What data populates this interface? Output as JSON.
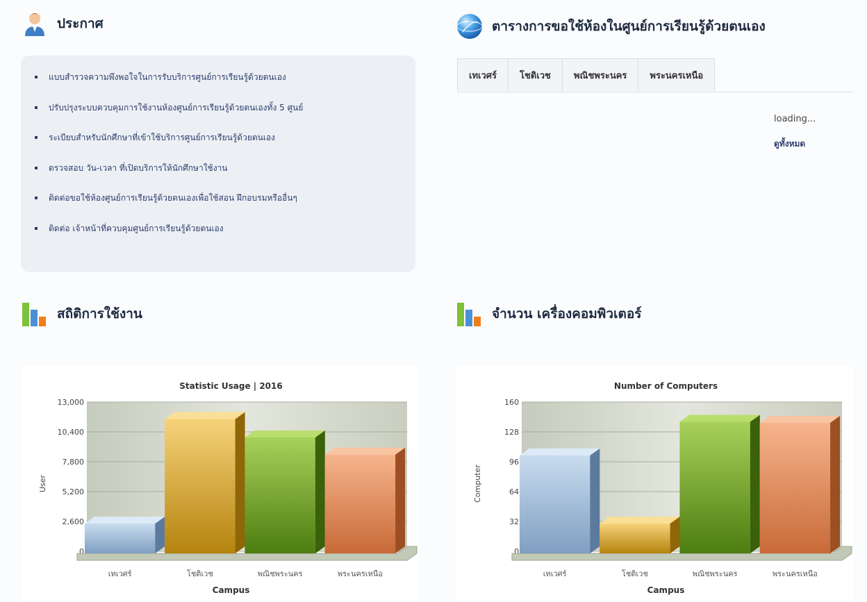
{
  "announcements": {
    "title": "ประกาศ",
    "items": [
      "แบบสำรวจความพึงพอใจในการรับบริการศูนย์การเรียนรู้ด้วยตนเอง",
      "ปรับปรุงระบบควบคุมการใช้งานห้องศูนย์การเรียนรู้ด้วยตนเองทั้ง 5 ศูนย์",
      "ระเบียบสำหรับนักศึกษาที่เข้าใช้บริการศูนย์การเรียนรู้ด้วยตนเอง",
      "ตรวจสอบ วัน-เวลา ที่เปิดบริการให้นักศึกษาใช้งาน",
      "ติดต่อขอใช้ห้องศูนย์การเรียนรู้ด้วยตนเองเพื่อใช้สอน ฝึกอบรมหรืออื่นๆ",
      "ติดต่อ เจ้าหน้าที่ควบคุมศูนย์การเรียนรู้ด้วยตนเอง"
    ]
  },
  "schedule": {
    "title": "ตารางการขอใช้ห้องในศูนย์การเรียนรู้ด้วยตนเอง",
    "tabs": [
      "เทเวศร์",
      "โชติเวช",
      "พณิชพระนคร",
      "พระนครเหนือ"
    ],
    "loading": "loading...",
    "view_all": "ดูทั้งหมด"
  },
  "stats_section": {
    "title": "สถิติการใช้งาน"
  },
  "computers_section": {
    "title": "จำนวน เครื่องคอมพิวเตอร์"
  },
  "colors": {
    "blue": "#a9c4e0",
    "yellow": "#d9a52a",
    "green": "#6a9a1e",
    "orange": "#e08a5a"
  },
  "chart_data": [
    {
      "type": "bar",
      "title": "Statistic Usage | 2016",
      "xlabel": "Campus",
      "ylabel": "User",
      "categories": [
        "เทเวศร์",
        "โชติเวช",
        "พณิชพระนคร",
        "พระนครเหนือ"
      ],
      "values": [
        2600,
        11700,
        10100,
        8600
      ],
      "ylim": [
        0,
        13000
      ],
      "yticks": [
        "0",
        "2,600",
        "5,200",
        "7,800",
        "10,400",
        "13,000"
      ],
      "grid": true
    },
    {
      "type": "bar",
      "title": "Number of Computers",
      "xlabel": "Campus",
      "ylabel": "Computer",
      "categories": [
        "เทเวศร์",
        "โชติเวช",
        "พณิชพระนคร",
        "พระนครเหนือ"
      ],
      "values": [
        105,
        32,
        141,
        140
      ],
      "ylim": [
        0,
        160
      ],
      "yticks": [
        "0",
        "32",
        "64",
        "96",
        "128",
        "160"
      ],
      "grid": true
    }
  ]
}
